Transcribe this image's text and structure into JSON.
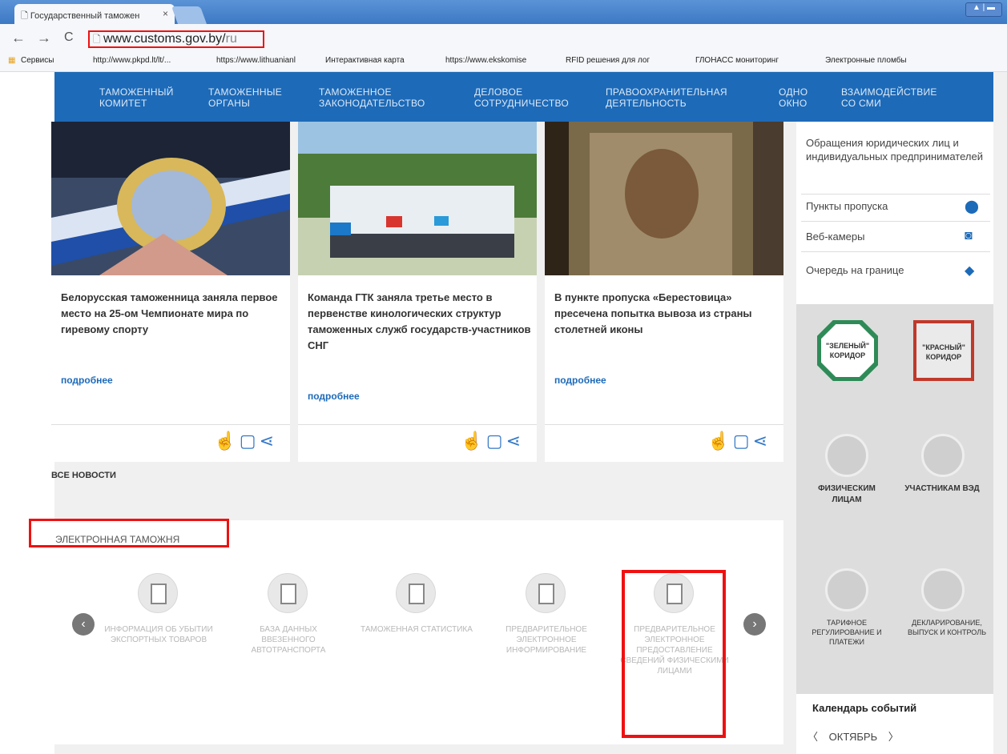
{
  "browser": {
    "tab_title": "Государственный таможен",
    "tab_close": "×",
    "url_host": "www.customs.gov.by/",
    "url_path": "ru",
    "win_buttons": "▲ | ▬",
    "bookmarks": [
      "Сервисы",
      "http://www.pkpd.lt/lt/...",
      "https://www.lithuanianl",
      "Интерактивная карта",
      "https://www.ekskomise",
      "RFID решения для лог",
      "ГЛОНАСС мониторинг",
      "Электронные пломбы"
    ]
  },
  "nav": [
    {
      "line1": "Таможенный",
      "line2": "комитет"
    },
    {
      "line1": "Таможенные",
      "line2": "органы"
    },
    {
      "line1": "Таможенное",
      "line2": "законодательство"
    },
    {
      "line1": "Деловое",
      "line2": "сотрудничество"
    },
    {
      "line1": "Правоохранительная",
      "line2": "деятельность"
    },
    {
      "line1": "Одно",
      "line2": "окно"
    },
    {
      "line1": "Взаимодействие",
      "line2": "со СМИ"
    }
  ],
  "news": [
    {
      "headline": "Белорусская таможенница заняла первое место на 25-ом Чемпионате мира по гиревому спорту",
      "more": "подробнее"
    },
    {
      "headline": "Команда ГТК заняла третье место в первенстве кинологических структур таможенных служб государств-участников СНГ",
      "more": "подробнее"
    },
    {
      "headline": "В пункте пропуска «Берестовица» пресечена попытка вывоза из страны столетней иконы",
      "more": "подробнее"
    }
  ],
  "all_news": "ВСЕ НОВОСТИ",
  "e_customs": {
    "title": "ЭЛЕКТРОННАЯ ТАМОЖНЯ",
    "items": [
      "Информация об убытии экспортных товаров",
      "База данных ввезенного автотранспорта",
      "Таможенная статистика",
      "Предварительное электронное информирование",
      "Предварительное электронное предоставление сведений физическими лицами"
    ],
    "prev": "‹",
    "next": "›"
  },
  "sidebar": {
    "appeals": "Обращения юридических лиц и индивидуальных предпринимателей",
    "links": [
      {
        "label": "Пункты пропуска",
        "icon": "map-pin-icon"
      },
      {
        "label": "Веб-камеры",
        "icon": "camera-icon"
      },
      {
        "label": "Очередь на границе",
        "icon": "car-icon"
      }
    ],
    "green_corridor": "\"ЗЕЛЕНЫЙ\" КОРИДОР",
    "red_corridor": "\"КРАСНЫЙ\" КОРИДОР",
    "individuals": "Физическим лицам",
    "participants": "Участникам ВЭД",
    "tariff": "Тарифное регулирование и платежи",
    "declaration": "Декларирование, выпуск и контроль",
    "calendar_title": "Календарь событий",
    "month": "ОКТЯБРЬ",
    "prev": "〈",
    "next": "〉"
  },
  "colors": {
    "nav": "#1d6ab8",
    "accent": "#1d6ab8",
    "highlight": "#e11111",
    "green": "#2e8b57",
    "red": "#c0392b"
  }
}
